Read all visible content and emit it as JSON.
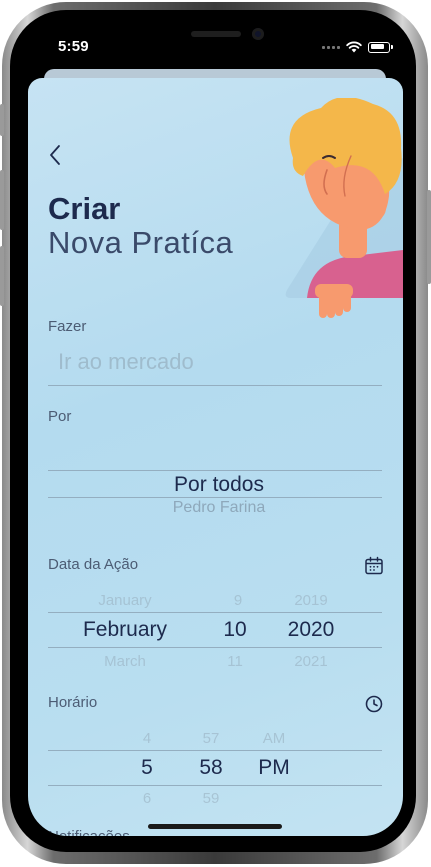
{
  "status_bar": {
    "time": "5:59"
  },
  "header": {
    "title_bold": "Criar",
    "title_light": "Nova Pratíca"
  },
  "task": {
    "label": "Fazer",
    "placeholder": "Ir ao mercado",
    "value": ""
  },
  "assignee": {
    "label": "Por",
    "selected": "Por todos",
    "next": "Pedro Farina"
  },
  "date": {
    "label": "Data da Ação",
    "icon": "calendar-icon",
    "prev": {
      "month": "January",
      "day": "9",
      "year": "2019"
    },
    "selected": {
      "month": "February",
      "day": "10",
      "year": "2020"
    },
    "next": {
      "month": "March",
      "day": "11",
      "year": "2021"
    }
  },
  "time": {
    "label": "Horário",
    "icon": "clock-icon",
    "prev": {
      "hour": "4",
      "minute": "57",
      "period": "AM"
    },
    "selected": {
      "hour": "5",
      "minute": "58",
      "period": "PM"
    },
    "next": {
      "hour": "6",
      "minute": "59",
      "period": ""
    }
  },
  "notifications": {
    "label": "Notificações"
  },
  "colors": {
    "accent_dark": "#1d2a4d",
    "background": "#bde0f1",
    "hair": "#f4b74a",
    "skin": "#f79a6e",
    "shirt": "#d8618f"
  }
}
